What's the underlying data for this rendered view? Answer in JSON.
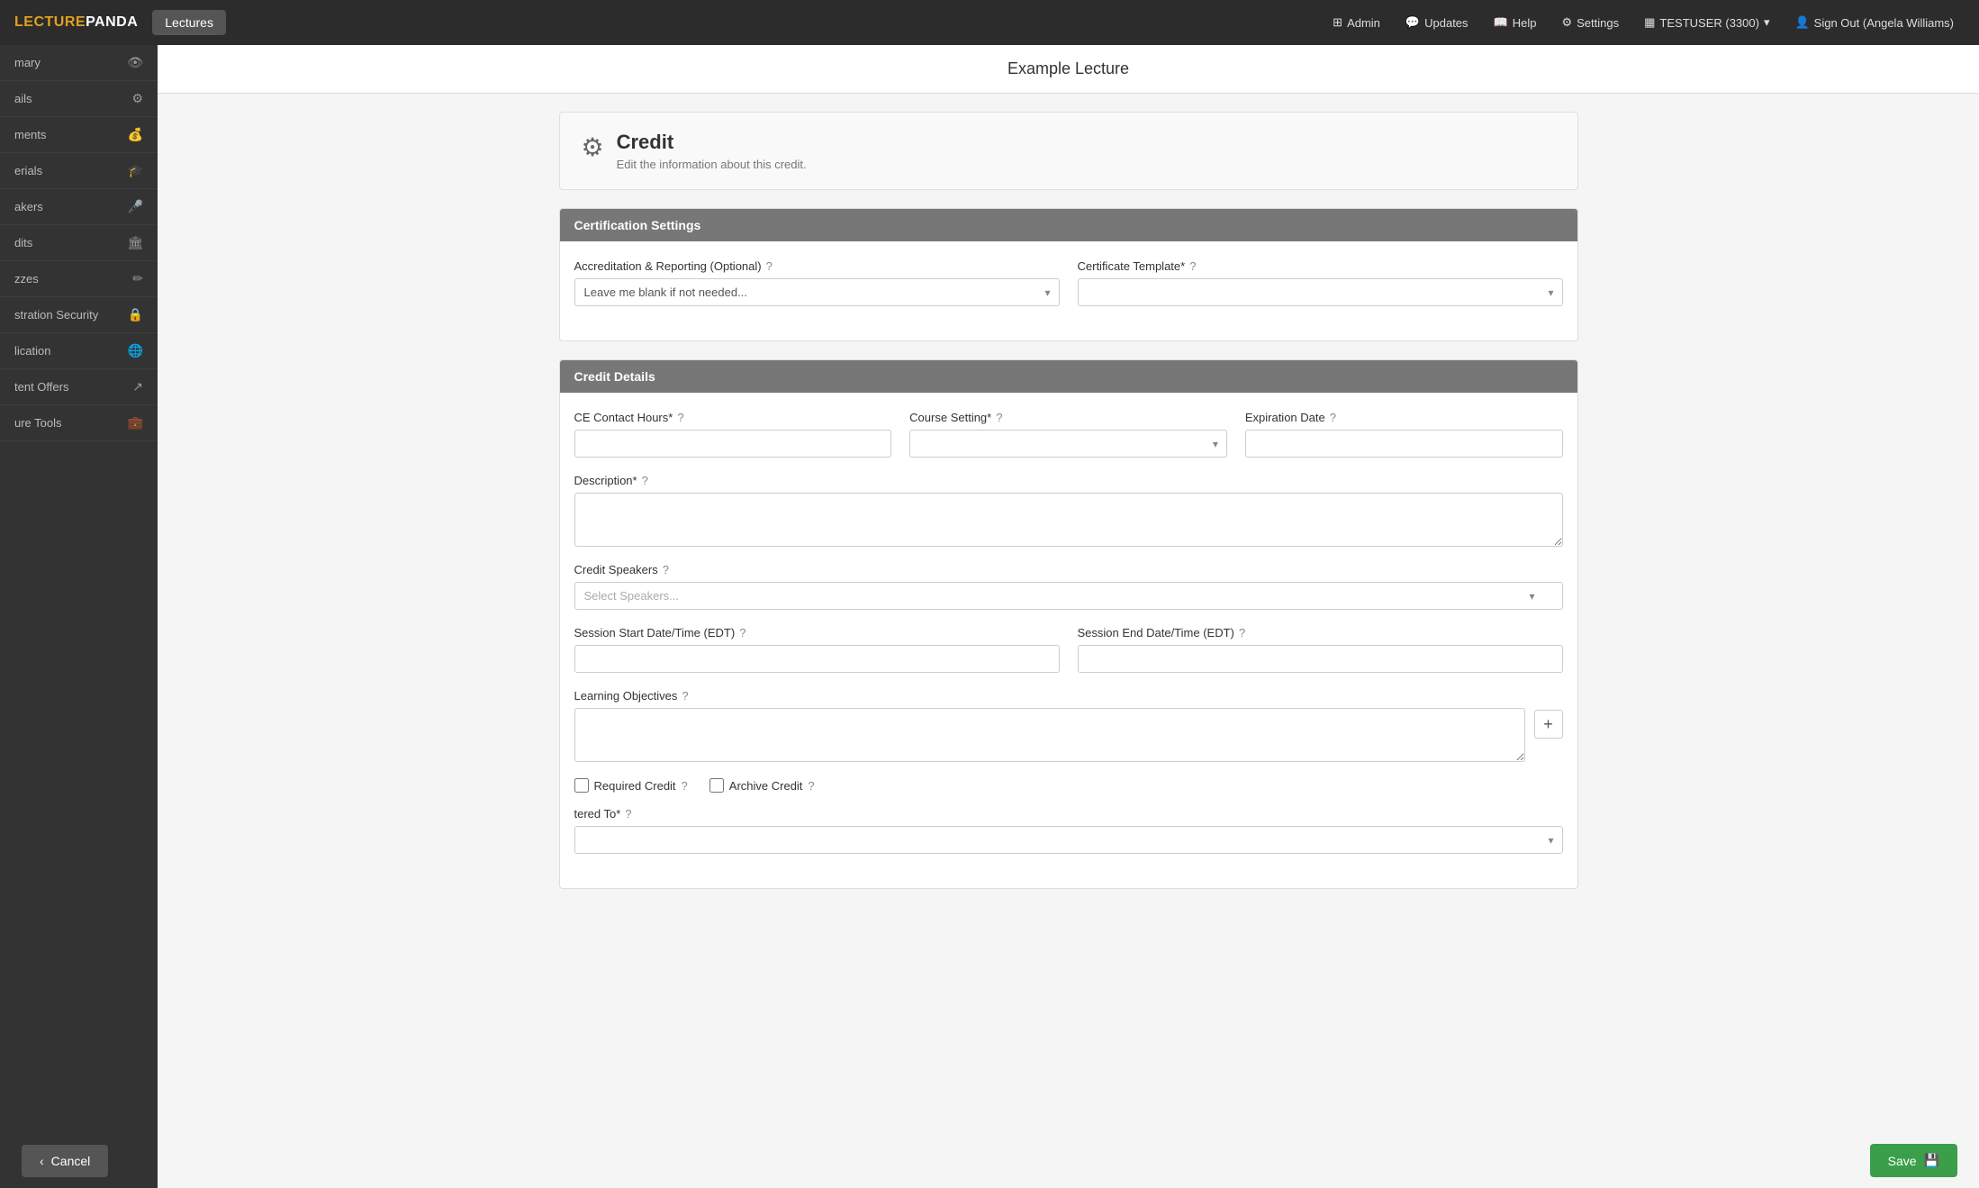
{
  "topNav": {
    "logo": "LECTUREPANDA",
    "lecturesTab": "Lectures",
    "navItems": [
      {
        "id": "admin",
        "icon": "⊞",
        "label": "Admin"
      },
      {
        "id": "updates",
        "icon": "💬",
        "label": "Updates"
      },
      {
        "id": "help",
        "icon": "📖",
        "label": "Help"
      },
      {
        "id": "settings",
        "icon": "⚙",
        "label": "Settings"
      },
      {
        "id": "testuser",
        "icon": "▦",
        "label": "TESTUSER (3300)",
        "hasDropdown": true
      },
      {
        "id": "signout",
        "icon": "👤",
        "label": "Sign Out (Angela Williams)"
      }
    ]
  },
  "sidebar": {
    "items": [
      {
        "id": "summary",
        "label": "mary",
        "icon": "👁"
      },
      {
        "id": "details",
        "label": "ails",
        "icon": "⚙"
      },
      {
        "id": "documents",
        "label": "ments",
        "icon": "💰"
      },
      {
        "id": "materials",
        "label": "erials",
        "icon": "🎓"
      },
      {
        "id": "speakers",
        "label": "akers",
        "icon": "🎤"
      },
      {
        "id": "credits",
        "label": "dits",
        "icon": "🏛"
      },
      {
        "id": "quizzes",
        "label": "zzes",
        "icon": "✏"
      },
      {
        "id": "registration",
        "label": "stration Security",
        "icon": "🔒"
      },
      {
        "id": "publication",
        "label": "lication",
        "icon": "🌐"
      },
      {
        "id": "content-offers",
        "label": "tent Offers",
        "icon": "↗"
      },
      {
        "id": "lecture-tools",
        "label": "ure Tools",
        "icon": "💼"
      }
    ]
  },
  "pageTitle": "Example Lecture",
  "creditSection": {
    "title": "Credit",
    "subtitle": "Edit the information about this credit.",
    "gearIcon": "⚙"
  },
  "certificationSettings": {
    "sectionTitle": "Certification Settings",
    "accreditationLabel": "Accreditation & Reporting (Optional)",
    "accreditationPlaceholder": "Leave me blank if not needed...",
    "certificateTemplateLabel": "Certificate Template*",
    "helpIcon": "?"
  },
  "creditDetails": {
    "sectionTitle": "Credit Details",
    "ceContactHoursLabel": "CE Contact Hours*",
    "ceHelpIcon": "?",
    "courseSettingLabel": "Course Setting*",
    "courseHelpIcon": "?",
    "expirationDateLabel": "Expiration Date",
    "expirationHelpIcon": "?",
    "descriptionLabel": "Description*",
    "descriptionHelpIcon": "?",
    "creditSpeakersLabel": "Credit Speakers",
    "speakersHelpIcon": "?",
    "speakersPlaceholder": "Select Speakers...",
    "sessionStartLabel": "Session Start Date/Time (EDT)",
    "sessionStartHelpIcon": "?",
    "sessionEndLabel": "Session End Date/Time (EDT)",
    "sessionEndHelpIcon": "?",
    "learningObjectivesLabel": "Learning Objectives",
    "learningObjectivesHelpIcon": "?",
    "addButtonLabel": "+",
    "requiredCreditLabel": "Required Credit",
    "requiredCreditHelpIcon": "?",
    "archiveCreditLabel": "Archive Credit",
    "archiveCreditHelpIcon": "?",
    "registeredToLabel": "tered To*",
    "registeredToHelpIcon": "?"
  },
  "bottomBar": {
    "cancelLabel": "Cancel",
    "cancelIcon": "‹",
    "saveLabel": "Save",
    "saveIcon": "💾"
  }
}
